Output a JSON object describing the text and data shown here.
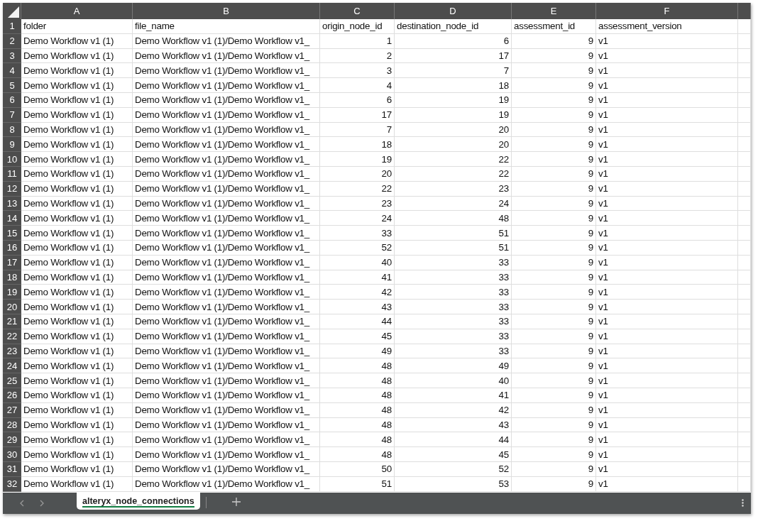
{
  "sheet": {
    "columns": [
      {
        "letter": "A",
        "kind": "text"
      },
      {
        "letter": "B",
        "kind": "text"
      },
      {
        "letter": "C",
        "kind": "number"
      },
      {
        "letter": "D",
        "kind": "number"
      },
      {
        "letter": "E",
        "kind": "number"
      },
      {
        "letter": "F",
        "kind": "text"
      }
    ],
    "rows": [
      {
        "number": "1",
        "cells": [
          "folder",
          "file_name",
          "origin_node_id",
          "destination_node_id",
          "assessment_id",
          "assessment_version"
        ]
      },
      {
        "number": "2",
        "cells": [
          "Demo Workflow v1 (1)",
          "Demo Workflow v1 (1)/Demo Workflow v1_",
          "1",
          "6",
          "9",
          "v1"
        ]
      },
      {
        "number": "3",
        "cells": [
          "Demo Workflow v1 (1)",
          "Demo Workflow v1 (1)/Demo Workflow v1_",
          "2",
          "17",
          "9",
          "v1"
        ]
      },
      {
        "number": "4",
        "cells": [
          "Demo Workflow v1 (1)",
          "Demo Workflow v1 (1)/Demo Workflow v1_",
          "3",
          "7",
          "9",
          "v1"
        ]
      },
      {
        "number": "5",
        "cells": [
          "Demo Workflow v1 (1)",
          "Demo Workflow v1 (1)/Demo Workflow v1_",
          "4",
          "18",
          "9",
          "v1"
        ]
      },
      {
        "number": "6",
        "cells": [
          "Demo Workflow v1 (1)",
          "Demo Workflow v1 (1)/Demo Workflow v1_",
          "6",
          "19",
          "9",
          "v1"
        ]
      },
      {
        "number": "7",
        "cells": [
          "Demo Workflow v1 (1)",
          "Demo Workflow v1 (1)/Demo Workflow v1_",
          "17",
          "19",
          "9",
          "v1"
        ]
      },
      {
        "number": "8",
        "cells": [
          "Demo Workflow v1 (1)",
          "Demo Workflow v1 (1)/Demo Workflow v1_",
          "7",
          "20",
          "9",
          "v1"
        ]
      },
      {
        "number": "9",
        "cells": [
          "Demo Workflow v1 (1)",
          "Demo Workflow v1 (1)/Demo Workflow v1_",
          "18",
          "20",
          "9",
          "v1"
        ]
      },
      {
        "number": "10",
        "cells": [
          "Demo Workflow v1 (1)",
          "Demo Workflow v1 (1)/Demo Workflow v1_",
          "19",
          "22",
          "9",
          "v1"
        ]
      },
      {
        "number": "11",
        "cells": [
          "Demo Workflow v1 (1)",
          "Demo Workflow v1 (1)/Demo Workflow v1_",
          "20",
          "22",
          "9",
          "v1"
        ]
      },
      {
        "number": "12",
        "cells": [
          "Demo Workflow v1 (1)",
          "Demo Workflow v1 (1)/Demo Workflow v1_",
          "22",
          "23",
          "9",
          "v1"
        ]
      },
      {
        "number": "13",
        "cells": [
          "Demo Workflow v1 (1)",
          "Demo Workflow v1 (1)/Demo Workflow v1_",
          "23",
          "24",
          "9",
          "v1"
        ]
      },
      {
        "number": "14",
        "cells": [
          "Demo Workflow v1 (1)",
          "Demo Workflow v1 (1)/Demo Workflow v1_",
          "24",
          "48",
          "9",
          "v1"
        ]
      },
      {
        "number": "15",
        "cells": [
          "Demo Workflow v1 (1)",
          "Demo Workflow v1 (1)/Demo Workflow v1_",
          "33",
          "51",
          "9",
          "v1"
        ]
      },
      {
        "number": "16",
        "cells": [
          "Demo Workflow v1 (1)",
          "Demo Workflow v1 (1)/Demo Workflow v1_",
          "52",
          "51",
          "9",
          "v1"
        ]
      },
      {
        "number": "17",
        "cells": [
          "Demo Workflow v1 (1)",
          "Demo Workflow v1 (1)/Demo Workflow v1_",
          "40",
          "33",
          "9",
          "v1"
        ]
      },
      {
        "number": "18",
        "cells": [
          "Demo Workflow v1 (1)",
          "Demo Workflow v1 (1)/Demo Workflow v1_",
          "41",
          "33",
          "9",
          "v1"
        ]
      },
      {
        "number": "19",
        "cells": [
          "Demo Workflow v1 (1)",
          "Demo Workflow v1 (1)/Demo Workflow v1_",
          "42",
          "33",
          "9",
          "v1"
        ]
      },
      {
        "number": "20",
        "cells": [
          "Demo Workflow v1 (1)",
          "Demo Workflow v1 (1)/Demo Workflow v1_",
          "43",
          "33",
          "9",
          "v1"
        ]
      },
      {
        "number": "21",
        "cells": [
          "Demo Workflow v1 (1)",
          "Demo Workflow v1 (1)/Demo Workflow v1_",
          "44",
          "33",
          "9",
          "v1"
        ]
      },
      {
        "number": "22",
        "cells": [
          "Demo Workflow v1 (1)",
          "Demo Workflow v1 (1)/Demo Workflow v1_",
          "45",
          "33",
          "9",
          "v1"
        ]
      },
      {
        "number": "23",
        "cells": [
          "Demo Workflow v1 (1)",
          "Demo Workflow v1 (1)/Demo Workflow v1_",
          "49",
          "33",
          "9",
          "v1"
        ]
      },
      {
        "number": "24",
        "cells": [
          "Demo Workflow v1 (1)",
          "Demo Workflow v1 (1)/Demo Workflow v1_",
          "48",
          "49",
          "9",
          "v1"
        ]
      },
      {
        "number": "25",
        "cells": [
          "Demo Workflow v1 (1)",
          "Demo Workflow v1 (1)/Demo Workflow v1_",
          "48",
          "40",
          "9",
          "v1"
        ]
      },
      {
        "number": "26",
        "cells": [
          "Demo Workflow v1 (1)",
          "Demo Workflow v1 (1)/Demo Workflow v1_",
          "48",
          "41",
          "9",
          "v1"
        ]
      },
      {
        "number": "27",
        "cells": [
          "Demo Workflow v1 (1)",
          "Demo Workflow v1 (1)/Demo Workflow v1_",
          "48",
          "42",
          "9",
          "v1"
        ]
      },
      {
        "number": "28",
        "cells": [
          "Demo Workflow v1 (1)",
          "Demo Workflow v1 (1)/Demo Workflow v1_",
          "48",
          "43",
          "9",
          "v1"
        ]
      },
      {
        "number": "29",
        "cells": [
          "Demo Workflow v1 (1)",
          "Demo Workflow v1 (1)/Demo Workflow v1_",
          "48",
          "44",
          "9",
          "v1"
        ]
      },
      {
        "number": "30",
        "cells": [
          "Demo Workflow v1 (1)",
          "Demo Workflow v1 (1)/Demo Workflow v1_",
          "48",
          "45",
          "9",
          "v1"
        ]
      },
      {
        "number": "31",
        "cells": [
          "Demo Workflow v1 (1)",
          "Demo Workflow v1 (1)/Demo Workflow v1_",
          "50",
          "52",
          "9",
          "v1"
        ]
      },
      {
        "number": "32",
        "cells": [
          "Demo Workflow v1 (1)",
          "Demo Workflow v1 (1)/Demo Workflow v1_",
          "51",
          "53",
          "9",
          "v1"
        ]
      }
    ]
  },
  "sheet_tabs": [
    {
      "label": "alteryx_node_connections",
      "selected": true
    }
  ]
}
